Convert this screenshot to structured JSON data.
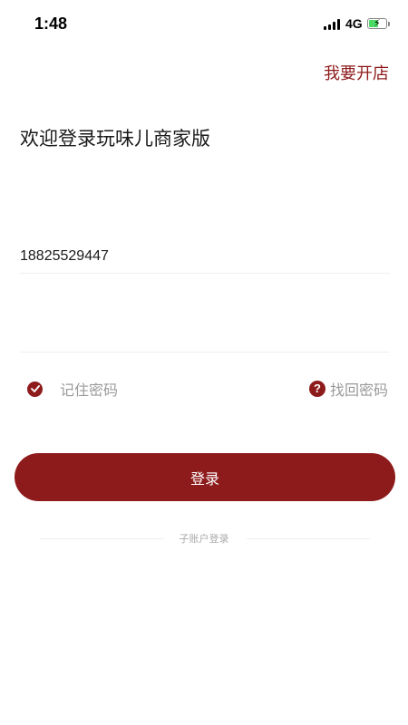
{
  "status_bar": {
    "time": "1:48",
    "network": "4G",
    "signal_icon": "signal-bars-icon",
    "battery_icon": "battery-charging-icon"
  },
  "header": {
    "open_store_link": "我要开店"
  },
  "welcome": {
    "title": "欢迎登录玩味儿商家版"
  },
  "form": {
    "phone_value": "18825529447",
    "password_value": ""
  },
  "options": {
    "remember_label": "记住密码",
    "remember_checked": true,
    "recover_icon_glyph": "?",
    "recover_label": "找回密码"
  },
  "actions": {
    "login_label": "登录",
    "sub_account_label": "子账户登录"
  },
  "colors": {
    "brand": "#8e1b1c",
    "hint_text": "#9a9a9a",
    "battery_fill": "#4cd964"
  }
}
